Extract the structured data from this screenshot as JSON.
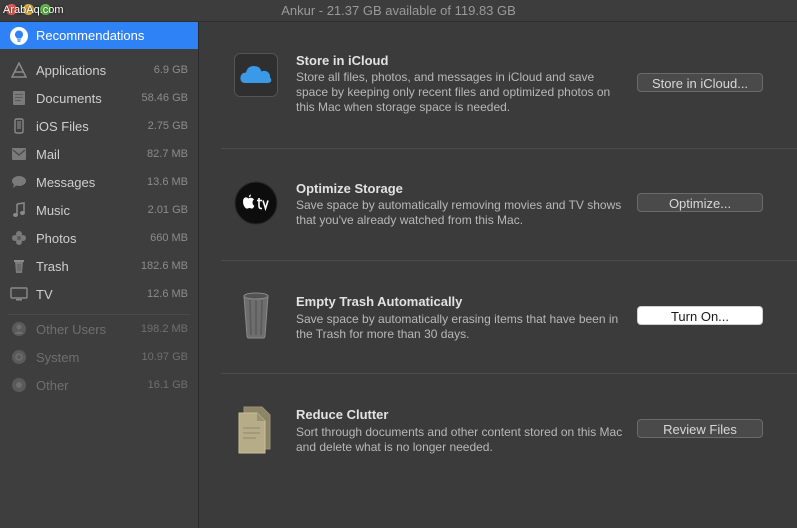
{
  "window": {
    "title": "Ankur - 21.37 GB available of 119.83 GB",
    "watermark": "ArabAq.com"
  },
  "sidebar": {
    "selected": {
      "label": "Recommendations"
    },
    "items": [
      {
        "label": "Applications",
        "size": "6.9 GB",
        "icon": "applications-icon"
      },
      {
        "label": "Documents",
        "size": "58.46 GB",
        "icon": "documents-icon"
      },
      {
        "label": "iOS Files",
        "size": "2.75 GB",
        "icon": "ios-files-icon"
      },
      {
        "label": "Mail",
        "size": "82.7 MB",
        "icon": "mail-icon"
      },
      {
        "label": "Messages",
        "size": "13.6 MB",
        "icon": "messages-icon"
      },
      {
        "label": "Music",
        "size": "2.01 GB",
        "icon": "music-icon"
      },
      {
        "label": "Photos",
        "size": "660 MB",
        "icon": "photos-icon"
      },
      {
        "label": "Trash",
        "size": "182.6 MB",
        "icon": "trash-icon"
      },
      {
        "label": "TV",
        "size": "12.6 MB",
        "icon": "tv-icon"
      }
    ],
    "other_items": [
      {
        "label": "Other Users",
        "size": "198.2 MB",
        "icon": "other-users-icon"
      },
      {
        "label": "System",
        "size": "10.97 GB",
        "icon": "system-icon"
      },
      {
        "label": "Other",
        "size": "16.1 GB",
        "icon": "other-icon"
      }
    ]
  },
  "recommendations": [
    {
      "title": "Store in iCloud",
      "description": "Store all files, photos, and messages in iCloud and save space by keeping only recent files and optimized photos on this Mac when storage space is needed.",
      "button": "Store in iCloud...",
      "icon": "icloud-icon"
    },
    {
      "title": "Optimize Storage",
      "description": "Save space by automatically removing movies and TV shows that you've already watched from this Mac.",
      "button": "Optimize...",
      "icon": "apple-tv-icon"
    },
    {
      "title": "Empty Trash Automatically",
      "description": "Save space by automatically erasing items that have been in the Trash for more than 30 days.",
      "button": "Turn On...",
      "icon": "trash-can-icon"
    },
    {
      "title": "Reduce Clutter",
      "description": "Sort through documents and other content stored on this Mac and delete what is no longer needed.",
      "button": "Review Files",
      "icon": "documents-stack-icon"
    }
  ],
  "colors": {
    "accent": "#2f82f5",
    "background": "#3b3b3b",
    "sidebar": "#3e3e3e"
  }
}
